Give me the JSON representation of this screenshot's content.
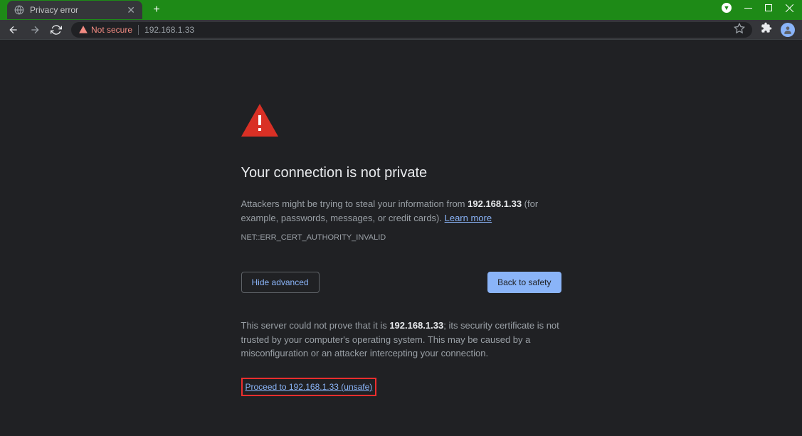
{
  "tab": {
    "title": "Privacy error"
  },
  "address_bar": {
    "security_label": "Not secure",
    "url": "192.168.1.33"
  },
  "error": {
    "title": "Your connection is not private",
    "body_prefix": "Attackers might be trying to steal your information from ",
    "body_host": "192.168.1.33",
    "body_suffix": " (for example, passwords, messages, or credit cards). ",
    "learn_more": "Learn more",
    "code": "NET::ERR_CERT_AUTHORITY_INVALID",
    "hide_advanced": "Hide advanced",
    "back_to_safety": "Back to safety",
    "advanced_prefix": "This server could not prove that it is ",
    "advanced_host": "192.168.1.33",
    "advanced_suffix": "; its security certificate is not trusted by your computer's operating system. This may be caused by a misconfiguration or an attacker intercepting your connection.",
    "proceed_link": "Proceed to 192.168.1.33 (unsafe)"
  }
}
